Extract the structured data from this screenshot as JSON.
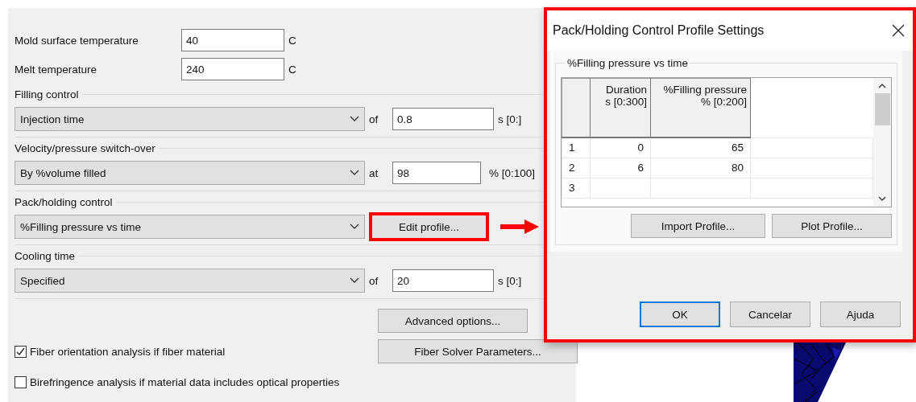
{
  "fields": [
    {
      "label": "Mold surface temperature",
      "value": "40",
      "unit": "C"
    },
    {
      "label": "Melt temperature",
      "value": "240",
      "unit": "C"
    }
  ],
  "groups": [
    {
      "kind": "value",
      "title": "Filling control",
      "select": "Injection time",
      "connector": "of",
      "value": "0.8",
      "unit": "s [0:]"
    },
    {
      "kind": "value",
      "title": "Velocity/pressure switch-over",
      "select": "By %volume filled",
      "connector": "at",
      "value": "98",
      "unit": "% [0:100]"
    },
    {
      "kind": "button",
      "title": "Pack/holding control",
      "select": "%Filling pressure vs time",
      "button": "Edit profile...",
      "highlighted": true
    },
    {
      "kind": "value",
      "title": "Cooling time",
      "select": "Specified",
      "connector": "of",
      "value": "20",
      "unit": "s [0:]"
    }
  ],
  "advanced_button": "Advanced options...",
  "checkboxes": [
    {
      "label": "Fiber orientation analysis if fiber material",
      "checked": true,
      "button": "Fiber Solver Parameters..."
    },
    {
      "label": "Birefringence analysis if material data includes optical properties",
      "checked": false
    }
  ],
  "dialog": {
    "title": "Pack/Holding Control Profile Settings",
    "highlighted": true,
    "group_title": "%Filling pressure vs time",
    "table": {
      "columns": [
        {
          "name": "Duration",
          "range": "s [0:300]"
        },
        {
          "name": "%Filling pressure",
          "range": "% [0:200]"
        }
      ],
      "rows": [
        {
          "index": "1",
          "cells": [
            "0",
            "65"
          ]
        },
        {
          "index": "2",
          "cells": [
            "6",
            "80"
          ]
        },
        {
          "index": "3",
          "cells": [
            "",
            ""
          ]
        }
      ]
    },
    "buttons": [
      "Import Profile...",
      "Plot Profile..."
    ],
    "footer_buttons": [
      {
        "label": "OK",
        "focused": true
      },
      {
        "label": "Cancelar",
        "focused": false
      },
      {
        "label": "Ajuda",
        "focused": false
      }
    ]
  }
}
